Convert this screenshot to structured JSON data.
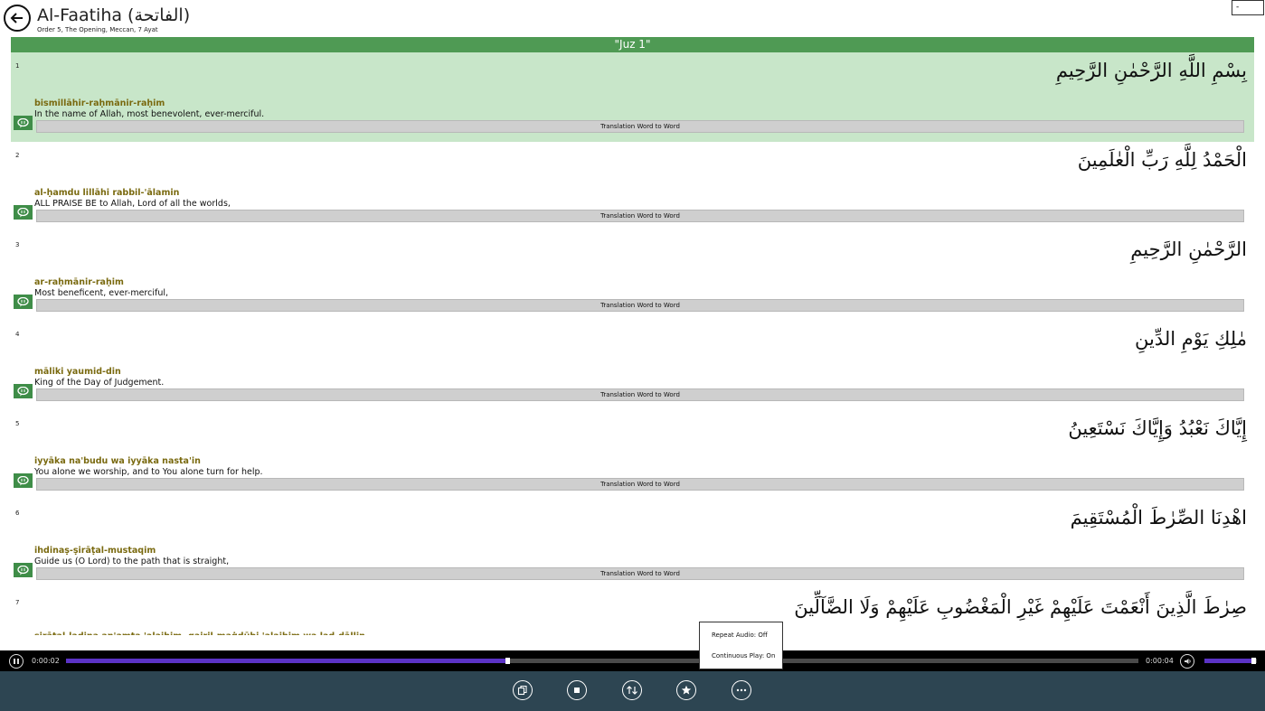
{
  "header": {
    "title": "Al-Faatiha (الفاتحة)",
    "subtitle": "Order 5, The Opening, Meccan, 7 Ayat",
    "top_right_box": "-"
  },
  "juz_label": "\"Juz 1\"",
  "w2w_label": "Translation Word to Word",
  "verses": [
    {
      "num": "1",
      "arabic": "بِسْمِ اللَّهِ الرَّحْمٰنِ الرَّحِيمِ",
      "translit": "bismillāhir-raḥmānir-raḥim",
      "translation": "In the name of Allah, most benevolent, ever-merciful.",
      "highlighted": true
    },
    {
      "num": "2",
      "arabic": "الْحَمْدُ لِلَّهِ رَبِّ الْعٰلَمِينَ",
      "translit": "al-ḥamdu lillāhi rabbil-'ālamin",
      "translation": "ALL PRAISE BE to Allah, Lord of all the worlds,",
      "highlighted": false
    },
    {
      "num": "3",
      "arabic": "الرَّحْمٰنِ الرَّحِيمِ",
      "translit": "ar-raḥmānir-raḥim",
      "translation": "Most beneficent, ever-merciful,",
      "highlighted": false
    },
    {
      "num": "4",
      "arabic": "مٰلِكِ يَوْمِ الدِّينِ",
      "translit": "māliki yaumid-din",
      "translation": "King of the Day of Judgement.",
      "highlighted": false
    },
    {
      "num": "5",
      "arabic": "إِيَّاكَ نَعْبُدُ وَإِيَّاكَ نَسْتَعِينُ",
      "translit": "iyyāka na'budu wa iyyāka nasta'in",
      "translation": "You alone we worship, and to You alone turn for help.",
      "highlighted": false
    },
    {
      "num": "6",
      "arabic": "اهْدِنَا الصِّرٰطَ الْمُسْتَقِيمَ",
      "translit": "ihdinaṣ-ṣirāṭal-mustaqim",
      "translation": "Guide us (O Lord) to the path that is straight,",
      "highlighted": false
    },
    {
      "num": "7",
      "arabic": "صِرٰطَ الَّذِينَ أَنْعَمْتَ عَلَيْهِمْ غَيْرِ الْمَغْضُوبِ عَلَيْهِمْ وَلَا الضَّآلِّينَ",
      "translit": "ṣirāṭal-laḍina an'amta 'alaihim, gairil-maġḍūbi 'alaihim wa laḍ-ḍāllin",
      "translation": "",
      "highlighted": false
    }
  ],
  "popup": {
    "repeat_audio": "Repeat Audio: Off",
    "continuous_play": "Continuous Play: On"
  },
  "player": {
    "current_time": "0:00:02",
    "total_time": "0:00:04",
    "progress": 0.41,
    "volume": 0.95
  },
  "colors": {
    "accent_green": "#4f9a54",
    "highlight": "#c8e6c9",
    "progress": "#5b33c6",
    "appbar": "#2d4552"
  },
  "app_bar_icons": [
    "copy-icon",
    "stop-icon",
    "repeat-icon",
    "favorite-icon",
    "more-icon"
  ]
}
